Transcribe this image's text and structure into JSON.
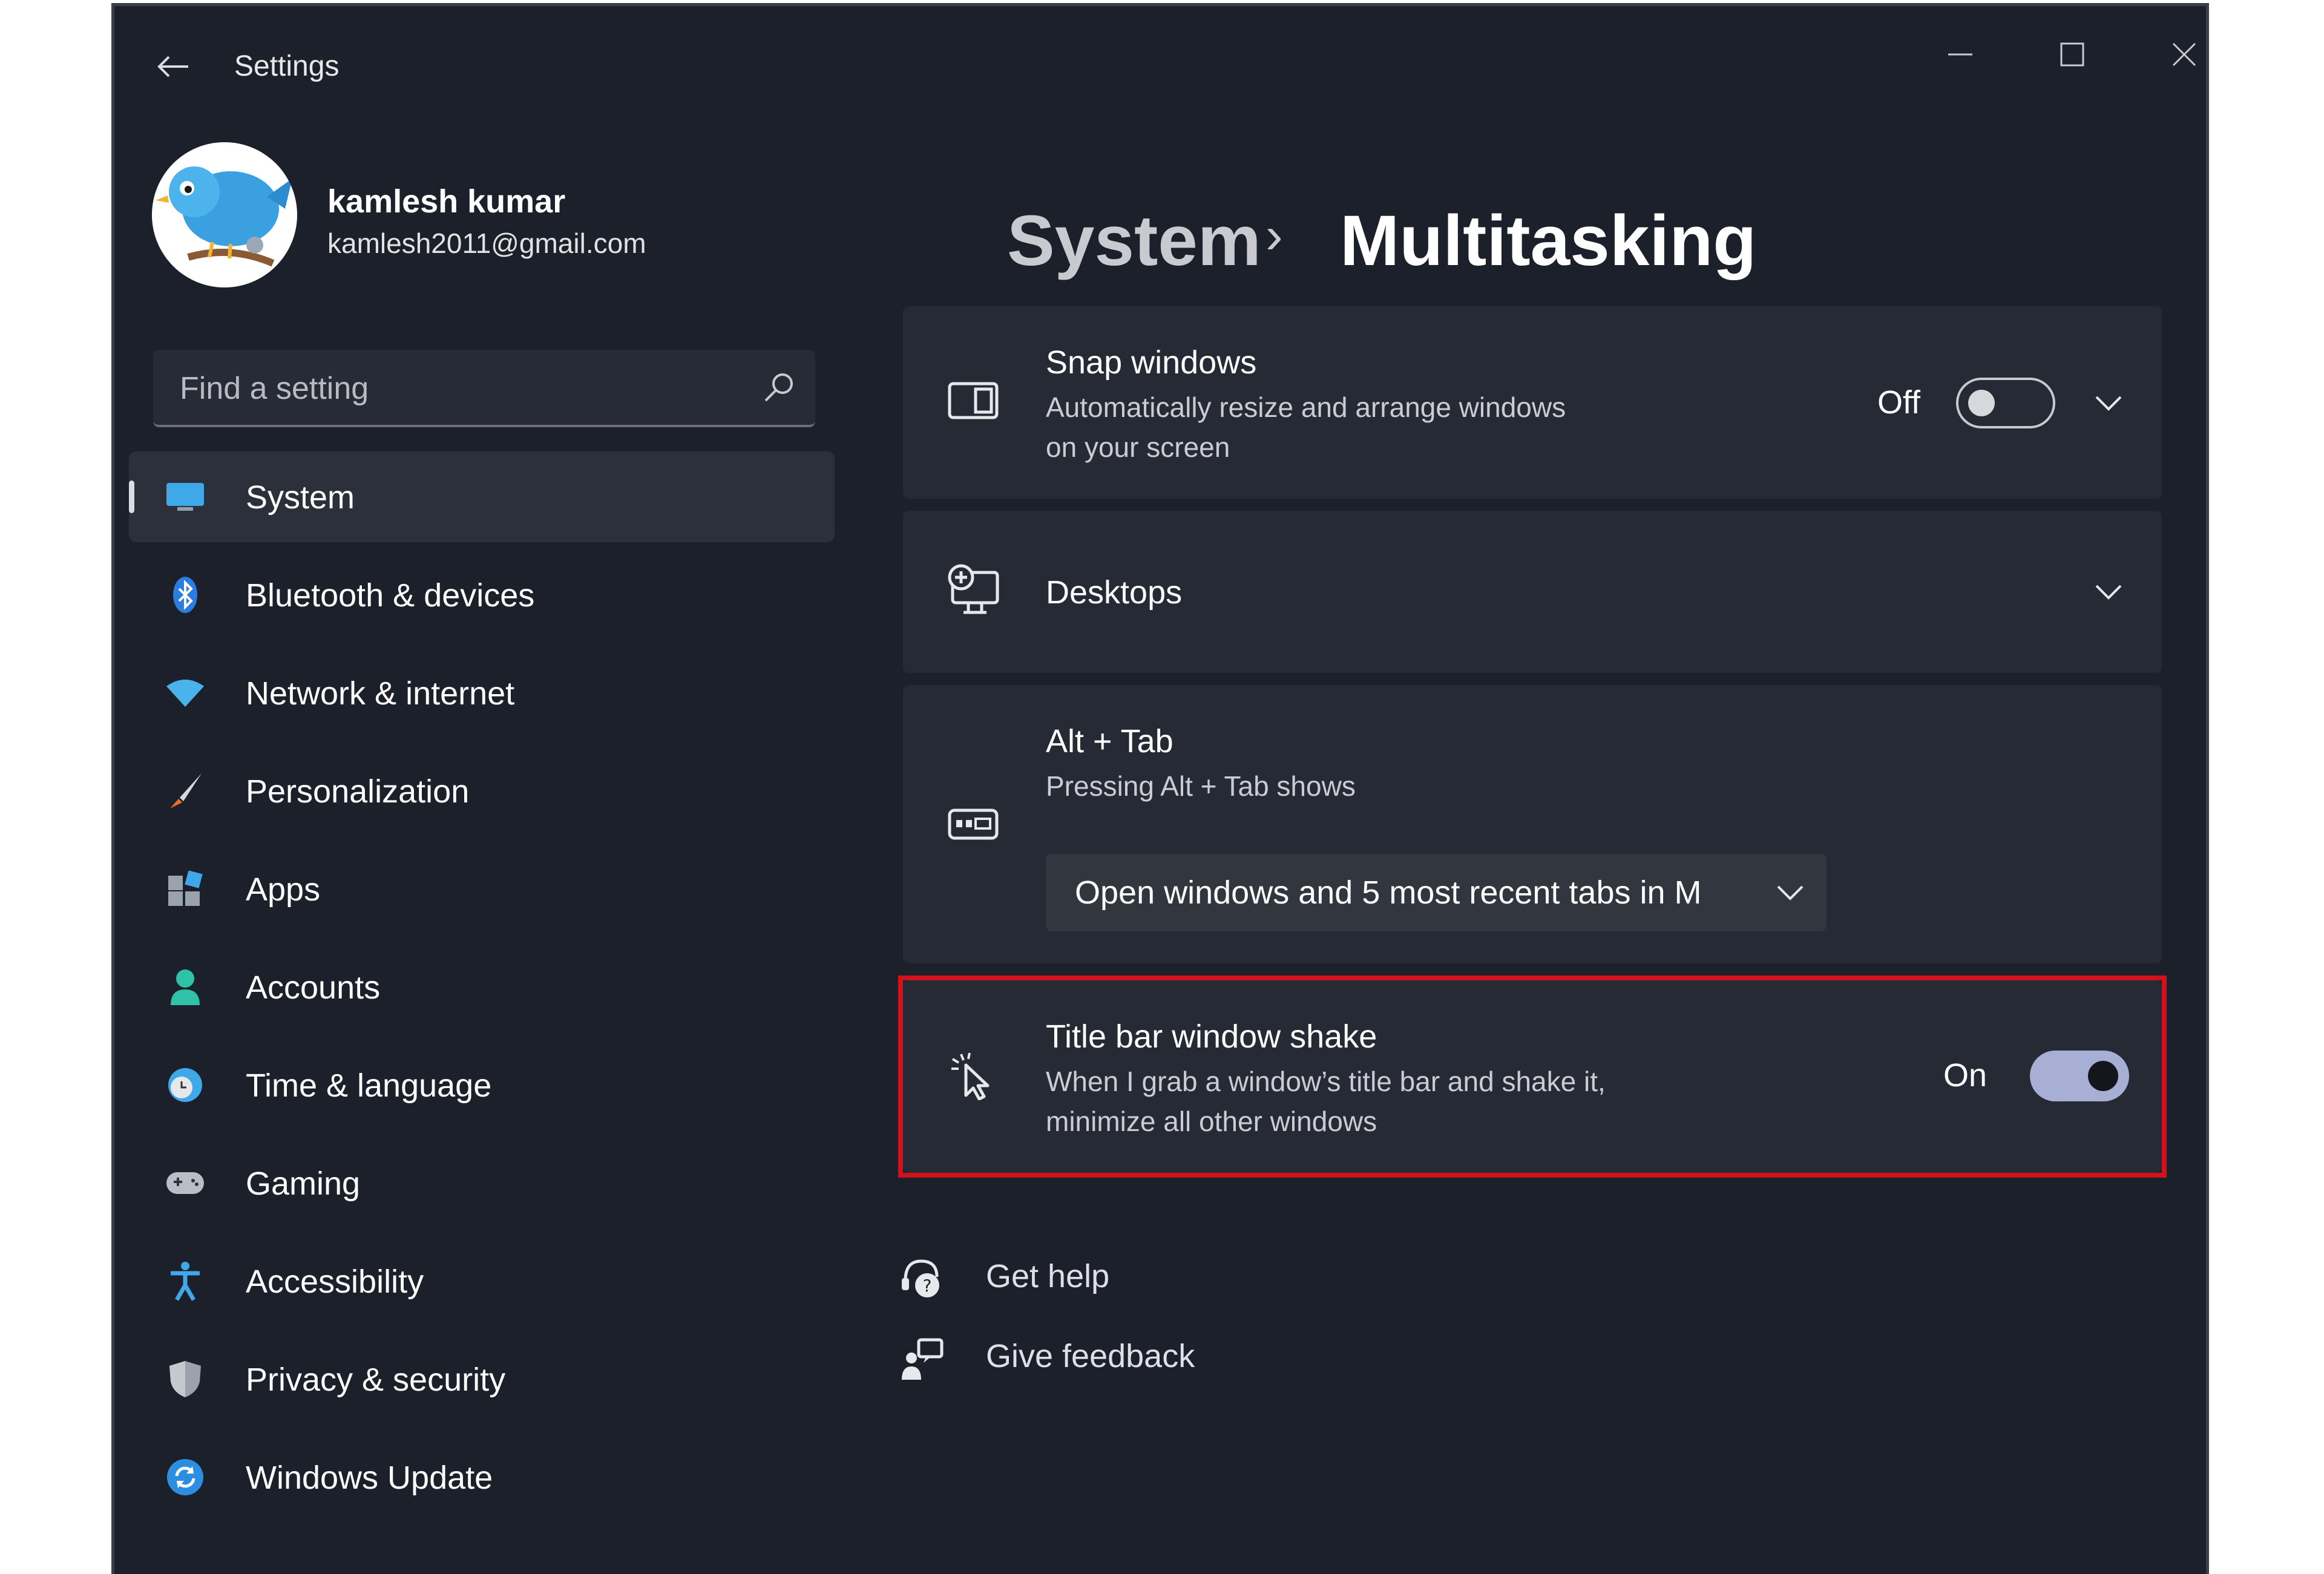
{
  "window": {
    "title": "Settings",
    "back_icon": "back-arrow-icon",
    "controls": [
      "minimize-icon",
      "maximize-icon",
      "close-icon"
    ]
  },
  "profile": {
    "name": "kamlesh kumar",
    "email": "kamlesh2011@gmail.com",
    "avatar_icon": "bird-avatar"
  },
  "search": {
    "placeholder": "Find a setting",
    "icon": "search-icon"
  },
  "nav": {
    "items": [
      {
        "label": "System",
        "icon": "system-display-icon",
        "selected": true
      },
      {
        "label": "Bluetooth & devices",
        "icon": "bluetooth-icon"
      },
      {
        "label": "Network & internet",
        "icon": "wifi-icon"
      },
      {
        "label": "Personalization",
        "icon": "brush-icon"
      },
      {
        "label": "Apps",
        "icon": "apps-icon"
      },
      {
        "label": "Accounts",
        "icon": "account-icon"
      },
      {
        "label": "Time & language",
        "icon": "clock-globe-icon"
      },
      {
        "label": "Gaming",
        "icon": "gamepad-icon"
      },
      {
        "label": "Accessibility",
        "icon": "accessibility-icon"
      },
      {
        "label": "Privacy & security",
        "icon": "shield-icon"
      },
      {
        "label": "Windows Update",
        "icon": "update-icon"
      }
    ]
  },
  "breadcrumb": {
    "parent": "System",
    "separator": "›",
    "current": "Multitasking"
  },
  "cards": {
    "snap": {
      "title": "Snap windows",
      "desc_line1": "Automatically resize and arrange windows",
      "desc_line2": "on your screen",
      "toggle_label": "Off",
      "toggle_on": false,
      "icon": "snap-layout-icon"
    },
    "desktops": {
      "title": "Desktops",
      "icon": "desktops-icon"
    },
    "alttab": {
      "title": "Alt + Tab",
      "desc": "Pressing Alt + Tab shows",
      "dropdown_value": "Open windows and 5 most recent tabs in M",
      "icon": "alt-tab-icon"
    },
    "shake": {
      "title": "Title bar window shake",
      "desc_line1": "When I grab a window’s title bar and shake it,",
      "desc_line2": "minimize all other windows",
      "toggle_label": "On",
      "toggle_on": true,
      "icon": "shake-cursor-icon"
    }
  },
  "links": {
    "help": "Get help",
    "feedback": "Give feedback"
  },
  "colors": {
    "window_bg": "#1c202b",
    "card_bg": "#262a34",
    "accent_toggle": "#a7b0d4",
    "highlight_border": "#d1121d"
  }
}
